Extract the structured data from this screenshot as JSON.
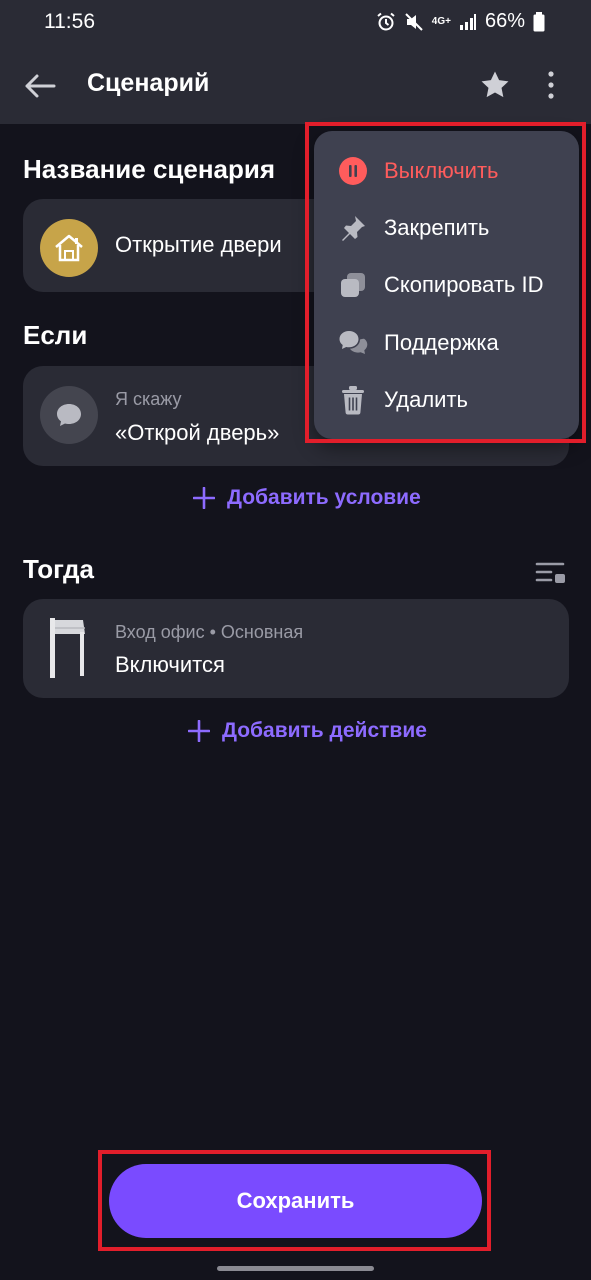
{
  "status_bar": {
    "time": "11:56",
    "network": "4G+",
    "battery": "66%"
  },
  "app_bar": {
    "title": "Сценарий"
  },
  "scenario_name": {
    "section_title": "Название сценария",
    "value": "Открытие двери"
  },
  "if_section": {
    "section_title": "Если",
    "trigger_label": "Я скажу",
    "trigger_value": "«Открой дверь»",
    "add_label": "Добавить условие"
  },
  "then_section": {
    "section_title": "Тогда",
    "device_label": "Вход офис • Основная",
    "action_value": "Включится",
    "add_label": "Добавить действие"
  },
  "menu": {
    "items": [
      {
        "label": "Выключить",
        "icon": "pause-icon",
        "color": "#ff5c5c"
      },
      {
        "label": "Закрепить",
        "icon": "pin-icon"
      },
      {
        "label": "Скопировать ID",
        "icon": "copy-icon"
      },
      {
        "label": "Поддержка",
        "icon": "chat-bubbles-icon"
      },
      {
        "label": "Удалить",
        "icon": "trash-icon"
      }
    ]
  },
  "footer": {
    "save_label": "Сохранить"
  },
  "colors": {
    "accent": "#7a4bff",
    "link": "#8d6bff",
    "danger": "#ff5c5c",
    "highlight": "#e21e2b"
  }
}
